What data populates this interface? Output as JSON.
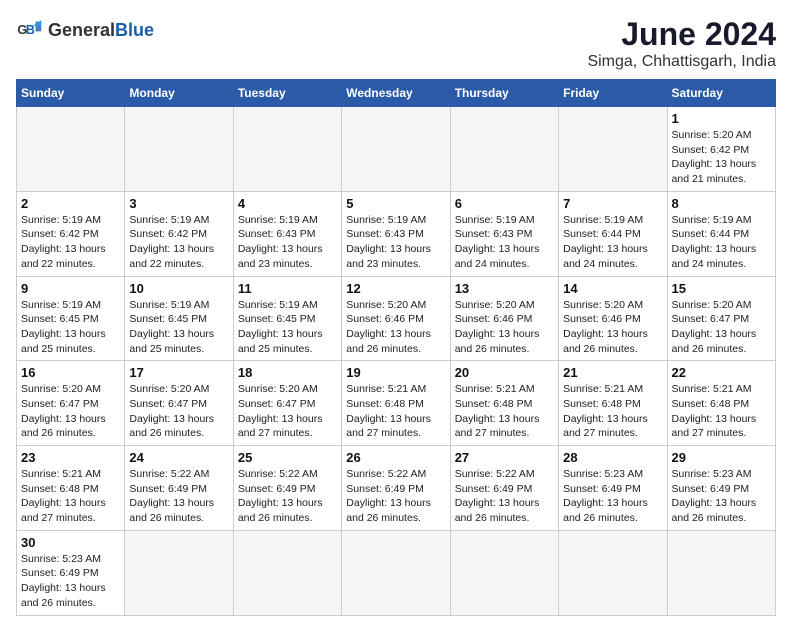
{
  "header": {
    "logo_general": "General",
    "logo_blue": "Blue",
    "month_year": "June 2024",
    "location": "Simga, Chhattisgarh, India"
  },
  "weekdays": [
    "Sunday",
    "Monday",
    "Tuesday",
    "Wednesday",
    "Thursday",
    "Friday",
    "Saturday"
  ],
  "days": [
    {
      "date": 1,
      "sunrise": "5:20 AM",
      "sunset": "6:42 PM",
      "daylight": "13 hours and 21 minutes."
    },
    {
      "date": 2,
      "sunrise": "5:19 AM",
      "sunset": "6:42 PM",
      "daylight": "13 hours and 22 minutes."
    },
    {
      "date": 3,
      "sunrise": "5:19 AM",
      "sunset": "6:42 PM",
      "daylight": "13 hours and 22 minutes."
    },
    {
      "date": 4,
      "sunrise": "5:19 AM",
      "sunset": "6:43 PM",
      "daylight": "13 hours and 23 minutes."
    },
    {
      "date": 5,
      "sunrise": "5:19 AM",
      "sunset": "6:43 PM",
      "daylight": "13 hours and 23 minutes."
    },
    {
      "date": 6,
      "sunrise": "5:19 AM",
      "sunset": "6:43 PM",
      "daylight": "13 hours and 24 minutes."
    },
    {
      "date": 7,
      "sunrise": "5:19 AM",
      "sunset": "6:44 PM",
      "daylight": "13 hours and 24 minutes."
    },
    {
      "date": 8,
      "sunrise": "5:19 AM",
      "sunset": "6:44 PM",
      "daylight": "13 hours and 24 minutes."
    },
    {
      "date": 9,
      "sunrise": "5:19 AM",
      "sunset": "6:45 PM",
      "daylight": "13 hours and 25 minutes."
    },
    {
      "date": 10,
      "sunrise": "5:19 AM",
      "sunset": "6:45 PM",
      "daylight": "13 hours and 25 minutes."
    },
    {
      "date": 11,
      "sunrise": "5:19 AM",
      "sunset": "6:45 PM",
      "daylight": "13 hours and 25 minutes."
    },
    {
      "date": 12,
      "sunrise": "5:20 AM",
      "sunset": "6:46 PM",
      "daylight": "13 hours and 26 minutes."
    },
    {
      "date": 13,
      "sunrise": "5:20 AM",
      "sunset": "6:46 PM",
      "daylight": "13 hours and 26 minutes."
    },
    {
      "date": 14,
      "sunrise": "5:20 AM",
      "sunset": "6:46 PM",
      "daylight": "13 hours and 26 minutes."
    },
    {
      "date": 15,
      "sunrise": "5:20 AM",
      "sunset": "6:47 PM",
      "daylight": "13 hours and 26 minutes."
    },
    {
      "date": 16,
      "sunrise": "5:20 AM",
      "sunset": "6:47 PM",
      "daylight": "13 hours and 26 minutes."
    },
    {
      "date": 17,
      "sunrise": "5:20 AM",
      "sunset": "6:47 PM",
      "daylight": "13 hours and 26 minutes."
    },
    {
      "date": 18,
      "sunrise": "5:20 AM",
      "sunset": "6:47 PM",
      "daylight": "13 hours and 27 minutes."
    },
    {
      "date": 19,
      "sunrise": "5:21 AM",
      "sunset": "6:48 PM",
      "daylight": "13 hours and 27 minutes."
    },
    {
      "date": 20,
      "sunrise": "5:21 AM",
      "sunset": "6:48 PM",
      "daylight": "13 hours and 27 minutes."
    },
    {
      "date": 21,
      "sunrise": "5:21 AM",
      "sunset": "6:48 PM",
      "daylight": "13 hours and 27 minutes."
    },
    {
      "date": 22,
      "sunrise": "5:21 AM",
      "sunset": "6:48 PM",
      "daylight": "13 hours and 27 minutes."
    },
    {
      "date": 23,
      "sunrise": "5:21 AM",
      "sunset": "6:48 PM",
      "daylight": "13 hours and 27 minutes."
    },
    {
      "date": 24,
      "sunrise": "5:22 AM",
      "sunset": "6:49 PM",
      "daylight": "13 hours and 26 minutes."
    },
    {
      "date": 25,
      "sunrise": "5:22 AM",
      "sunset": "6:49 PM",
      "daylight": "13 hours and 26 minutes."
    },
    {
      "date": 26,
      "sunrise": "5:22 AM",
      "sunset": "6:49 PM",
      "daylight": "13 hours and 26 minutes."
    },
    {
      "date": 27,
      "sunrise": "5:22 AM",
      "sunset": "6:49 PM",
      "daylight": "13 hours and 26 minutes."
    },
    {
      "date": 28,
      "sunrise": "5:23 AM",
      "sunset": "6:49 PM",
      "daylight": "13 hours and 26 minutes."
    },
    {
      "date": 29,
      "sunrise": "5:23 AM",
      "sunset": "6:49 PM",
      "daylight": "13 hours and 26 minutes."
    },
    {
      "date": 30,
      "sunrise": "5:23 AM",
      "sunset": "6:49 PM",
      "daylight": "13 hours and 26 minutes."
    }
  ],
  "labels": {
    "sunrise": "Sunrise:",
    "sunset": "Sunset:",
    "daylight": "Daylight:"
  },
  "colors": {
    "header_bg": "#2B5BA8",
    "empty_bg": "#f5f5f5"
  }
}
